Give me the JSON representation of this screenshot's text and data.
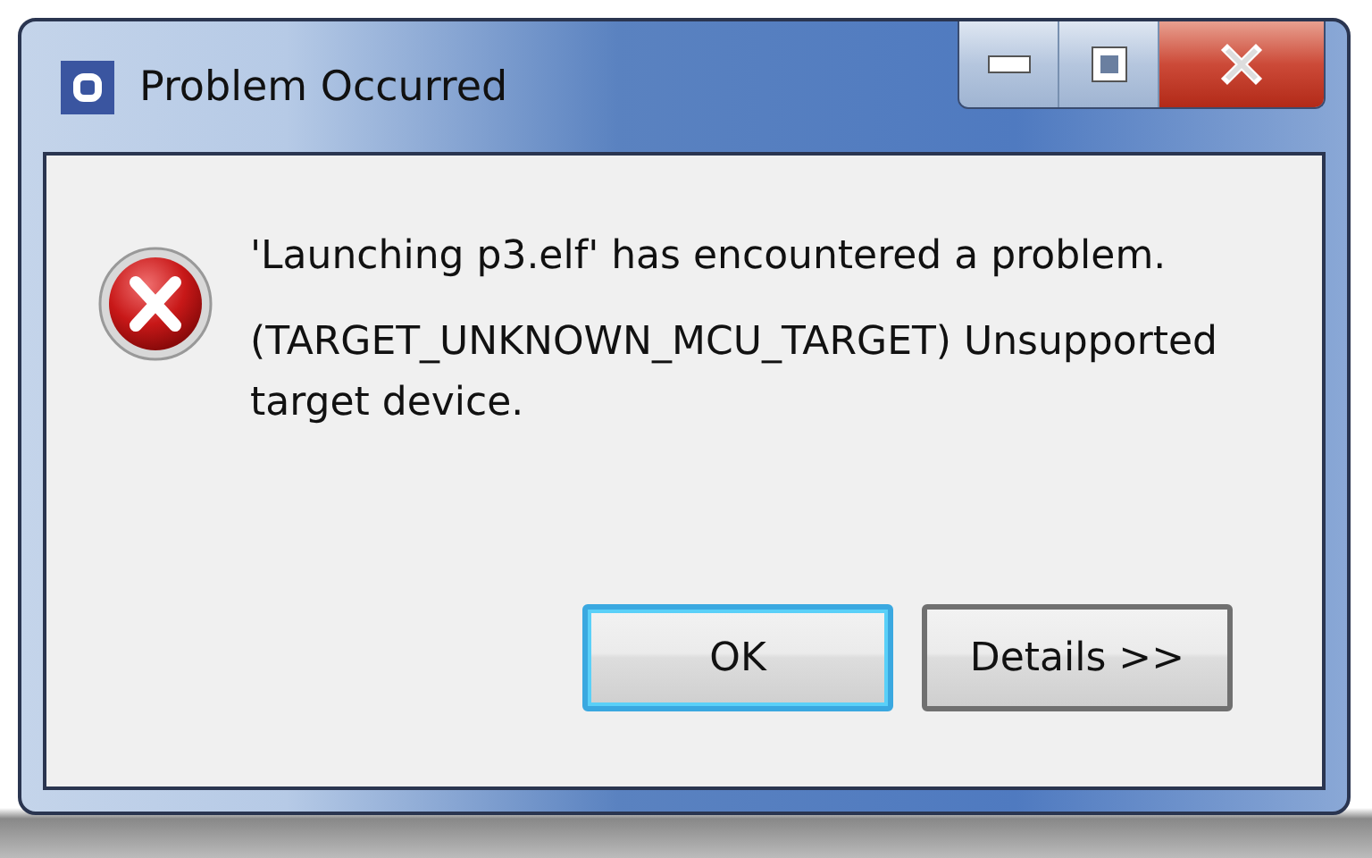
{
  "window": {
    "title": "Problem Occurred"
  },
  "message": {
    "kind": "error",
    "lines": [
      "'Launching p3.elf' has encountered a problem.",
      "(TARGET_UNKNOWN_MCU_TARGET) Unsupported target device."
    ]
  },
  "buttons": [
    {
      "label": "OK",
      "default": true
    },
    {
      "label": "Details >>",
      "default": false
    }
  ]
}
